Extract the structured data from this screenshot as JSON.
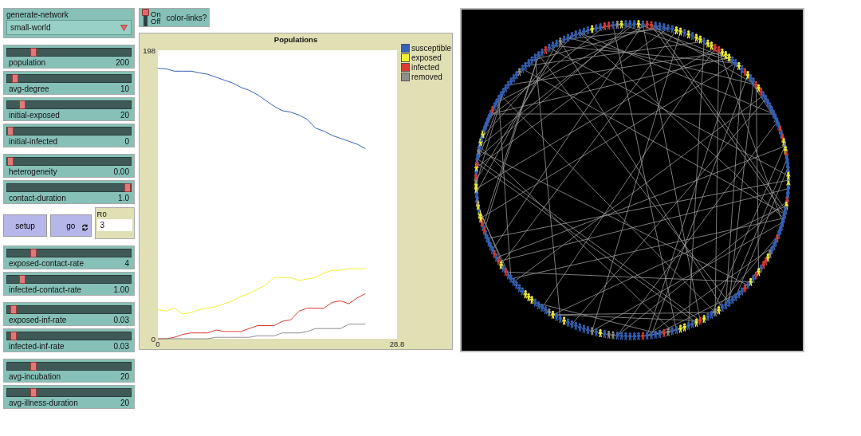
{
  "left_panel": [
    {
      "widgets": [
        {
          "kind": "chooser",
          "label": "generate-network",
          "value": "small-world"
        }
      ]
    },
    {
      "widgets": [
        {
          "kind": "slider",
          "label": "population",
          "value": "200",
          "level": 0.2
        },
        {
          "kind": "slider",
          "label": "avg-degree",
          "value": "10",
          "level": 0.04
        },
        {
          "kind": "slider",
          "label": "initial-exposed",
          "value": "20",
          "level": 0.1
        },
        {
          "kind": "slider",
          "label": "initial-infected",
          "value": "0",
          "level": 0
        }
      ]
    },
    {
      "widgets": [
        {
          "kind": "slider",
          "label": "heterogeneity",
          "value": "0.00",
          "level": 0
        },
        {
          "kind": "slider",
          "label": "contact-duration",
          "value": "1.0",
          "level": 1
        }
      ]
    },
    {
      "widgets": [
        {
          "kind": "controls",
          "buttons": [
            {
              "label": "setup",
              "forever": false
            },
            {
              "label": "go",
              "forever": true
            }
          ],
          "monitor": {
            "label": "R0",
            "value": "3"
          }
        }
      ]
    },
    {
      "widgets": [
        {
          "kind": "slider",
          "label": "exposed-contact-rate",
          "value": "4",
          "level": 0.2
        },
        {
          "kind": "slider",
          "label": "infected-contact-rate",
          "value": "1.00",
          "level": 0.1
        }
      ]
    },
    {
      "widgets": [
        {
          "kind": "slider",
          "label": "exposed-inf-rate",
          "value": "0.03",
          "level": 0.03
        },
        {
          "kind": "slider",
          "label": "infected-inf-rate",
          "value": "0.03",
          "level": 0.03
        }
      ]
    },
    {
      "widgets": [
        {
          "kind": "slider",
          "label": "avg-incubation",
          "value": "20",
          "level": 0.2
        },
        {
          "kind": "slider",
          "label": "avg-illness-duration",
          "value": "20",
          "level": 0.2
        }
      ]
    }
  ],
  "switch": {
    "label": "color-links?",
    "on_label": "On",
    "off_label": "Off",
    "on": true
  },
  "plot": {
    "chart_data": {
      "type": "line",
      "title": "Populations",
      "x": [
        0,
        1,
        2,
        3,
        4,
        5,
        6,
        7,
        8,
        9,
        10,
        11,
        12,
        13,
        14,
        15,
        16,
        17,
        18,
        19,
        20,
        21,
        22,
        23,
        24,
        25
      ],
      "xlim": [
        0,
        28.8
      ],
      "ylim": [
        0,
        198
      ],
      "xticks": [
        0,
        28.8
      ],
      "yticks": [
        0,
        198
      ],
      "series": [
        {
          "name": "susceptible",
          "color": "#3461b5",
          "values": [
            185.6,
            185.2,
            183.6,
            183.6,
            183.6,
            182.5,
            181.5,
            179.5,
            177.5,
            175.5,
            172.5,
            170.5,
            167.5,
            163.5,
            159.5,
            156.5,
            155.5,
            153.5,
            150.5,
            144.5,
            142.5,
            139.5,
            137.5,
            135.5,
            133.5,
            130.5
          ]
        },
        {
          "name": "exposed",
          "color": "#f0f032",
          "values": [
            20,
            19,
            21,
            17,
            18,
            20,
            21,
            22,
            24,
            26,
            29,
            31,
            34,
            37,
            42,
            42,
            42,
            40,
            41,
            42,
            45,
            47,
            47,
            48,
            48,
            48
          ]
        },
        {
          "name": "infected",
          "color": "#d93a32",
          "values": [
            0,
            0,
            1,
            3,
            4,
            4,
            4,
            6,
            5,
            5,
            5,
            7,
            9,
            9,
            9,
            12,
            13,
            19,
            21,
            21,
            21,
            25,
            26,
            24,
            28,
            31
          ]
        },
        {
          "name": "removed",
          "color": "#8d8d8d",
          "values": [
            0,
            0,
            0,
            0,
            0,
            0,
            0,
            1,
            1,
            1,
            1,
            1,
            2,
            2,
            2,
            4,
            4,
            4,
            5,
            7,
            7,
            7,
            7,
            10,
            10,
            10
          ]
        }
      ]
    }
  }
}
